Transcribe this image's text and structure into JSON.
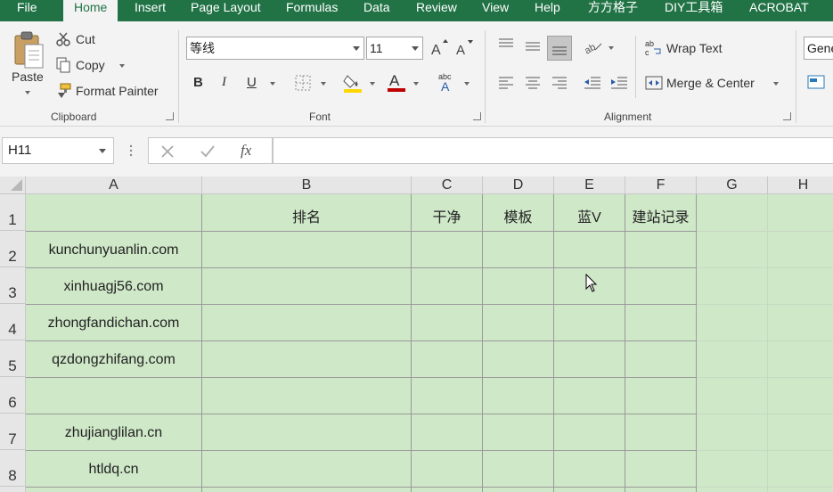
{
  "menu": {
    "tabs": [
      "File",
      "Home",
      "Insert",
      "Page Layout",
      "Formulas",
      "Data",
      "Review",
      "View",
      "Help",
      "方方格子",
      "DIY工具箱",
      "ACROBAT"
    ]
  },
  "ribbon": {
    "clipboard": {
      "paste": "Paste",
      "cut": "Cut",
      "copy": "Copy",
      "format_painter": "Format Painter",
      "label": "Clipboard"
    },
    "font": {
      "name": "等线",
      "size": "11",
      "bold": "B",
      "italic": "I",
      "underline": "U",
      "label": "Font",
      "fill_color": "#ffd700",
      "font_color": "#c00000"
    },
    "alignment": {
      "wrap_text": "Wrap Text",
      "merge_center": "Merge & Center",
      "label": "Alignment"
    },
    "number": {
      "format": "Gene"
    }
  },
  "formula_bar": {
    "name_box": "H11",
    "fx": "fx",
    "value": ""
  },
  "sheet": {
    "columns": [
      "A",
      "B",
      "C",
      "D",
      "E",
      "F",
      "G",
      "H"
    ],
    "rows": [
      "1",
      "2",
      "3",
      "4",
      "5",
      "6",
      "7",
      "8"
    ],
    "header_row": [
      "",
      "排名",
      "干净",
      "模板",
      "蓝V",
      "建站记录"
    ],
    "col_a": [
      "kunchunyuanlin.com",
      "xinhuagj56.com",
      "zhongfandichan.com",
      "qzdongzhifang.com",
      "",
      "zhujianglilan.cn",
      "htldq.cn"
    ],
    "cell_fill": "#cfe8c8"
  }
}
